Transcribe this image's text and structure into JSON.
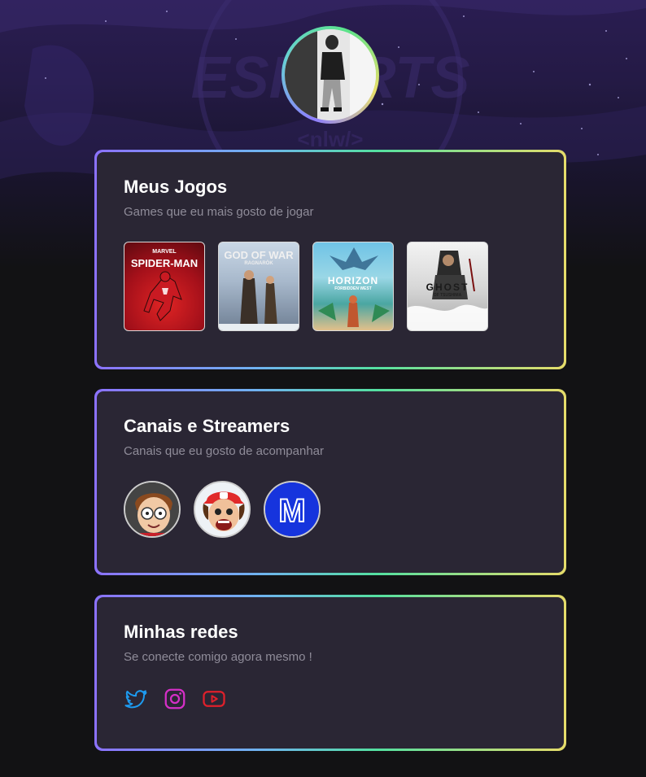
{
  "profile": {
    "avatar_alt": "Foto de perfil"
  },
  "games_card": {
    "title": "Meus Jogos",
    "subtitle": "Games que eu mais gosto de jogar",
    "games": [
      {
        "title": "SPIDER-MAN",
        "tag": "MARVEL"
      },
      {
        "title": "GOD OF WAR",
        "tag": "RAGNARÖK"
      },
      {
        "title": "HORIZON",
        "tag": "FORBIDDEN WEST"
      },
      {
        "title": "GHOST",
        "tag": "OF TSUSHIMA"
      }
    ]
  },
  "streamers_card": {
    "title": "Canais e Streamers",
    "subtitle": "Canais que eu gosto de acompanhar",
    "streamers": [
      {
        "initial": ""
      },
      {
        "initial": ""
      },
      {
        "initial": "M"
      }
    ]
  },
  "socials_card": {
    "title": "Minhas redes",
    "subtitle": "Se conecte comigo agora mesmo !",
    "links": [
      {
        "icon": "twitter-icon",
        "color": "#1d9bf0"
      },
      {
        "icon": "instagram-icon",
        "color": "#d62fc7"
      },
      {
        "icon": "youtube-icon",
        "color": "#e0202b"
      }
    ]
  },
  "colors": {
    "background": "#121214",
    "card": "#2a2634",
    "title": "#ffffff",
    "subtitle": "#8f8c99"
  }
}
